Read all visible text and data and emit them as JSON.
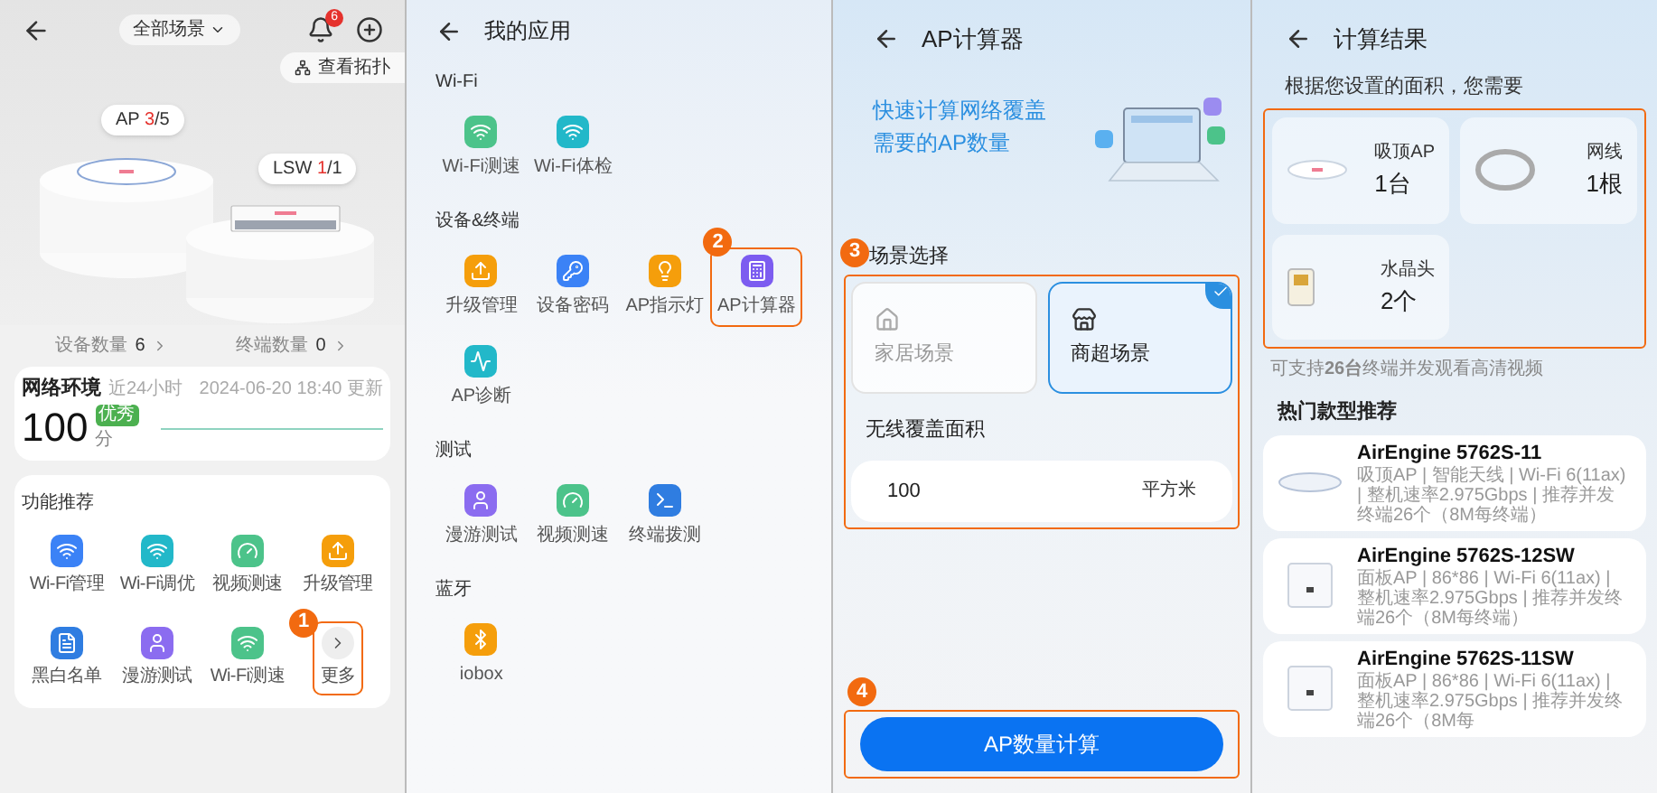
{
  "home": {
    "scope": "全部场景",
    "notifications": "6",
    "topology": "查看拓扑",
    "devices": [
      {
        "name": "AP",
        "online": "3",
        "rest": "/5"
      },
      {
        "name": "LSW",
        "online": "1",
        "rest": "/1"
      }
    ],
    "stats": [
      {
        "label": "设备数量",
        "value": "6"
      },
      {
        "label": "终端数量",
        "value": "0"
      }
    ],
    "network": {
      "title": "网络环境",
      "period": "近24小时",
      "updated": "2024-06-20 18:40 更新",
      "score": "100",
      "grade": "优秀",
      "unit": "分"
    },
    "features": {
      "title": "功能推荐",
      "items": [
        {
          "kind": "app",
          "label": "Wi-Fi管理"
        },
        {
          "kind": "app",
          "label": "Wi-Fi调优"
        },
        {
          "kind": "app",
          "label": "视频测速"
        },
        {
          "kind": "app",
          "label": "升级管理"
        },
        {
          "kind": "app",
          "label": "黑白名单"
        },
        {
          "kind": "app",
          "label": "漫游测试"
        },
        {
          "kind": "app",
          "label": "Wi-Fi测速"
        },
        {
          "kind": "more",
          "label": "更多",
          "step": "1"
        }
      ]
    }
  },
  "apps": {
    "title": "我的应用",
    "sections": [
      {
        "title": "Wi-Fi",
        "items": [
          {
            "label": "Wi-Fi测速"
          },
          {
            "label": "Wi-Fi体检"
          }
        ]
      },
      {
        "title": "设备&终端",
        "items": [
          {
            "label": "升级管理"
          },
          {
            "label": "设备密码"
          },
          {
            "label": "AP指示灯"
          },
          {
            "label": "AP计算器",
            "step": "2"
          },
          {
            "label": "AP诊断"
          }
        ]
      },
      {
        "title": "测试",
        "items": [
          {
            "label": "漫游测试"
          },
          {
            "label": "视频测速"
          },
          {
            "label": "终端拨测"
          }
        ]
      },
      {
        "title": "蓝牙",
        "items": [
          {
            "label": "iobox"
          }
        ]
      }
    ]
  },
  "calculator": {
    "title": "AP计算器",
    "tagline": [
      "快速计算网络覆盖",
      "需要的AP数量"
    ],
    "scene_title": "场景选择",
    "step": "3",
    "scenes": [
      {
        "label": "家居场景",
        "selected": false
      },
      {
        "label": "商超场景",
        "selected": true
      }
    ],
    "area_label": "无线覆盖面积",
    "area_value": "100",
    "area_unit": "平方米",
    "button": "AP数量计算",
    "button_step": "4"
  },
  "result": {
    "title": "计算结果",
    "subtitle": "根据您设置的面积，您需要",
    "items": [
      {
        "name": "吸顶AP",
        "amount": "1台"
      },
      {
        "name": "网线",
        "amount": "1根"
      },
      {
        "name": "水晶头",
        "amount": "2个"
      }
    ],
    "note": "可支持**26台**终端并发观看高清视频",
    "recommend_title": "热门款型推荐",
    "products": [
      {
        "kind": "ceiling",
        "name": "AirEngine 5762S-11",
        "desc": "吸顶AP | 智能天线 | Wi-Fi 6(11ax) | 整机速率2.975Gbps | 推荐并发终端26个（8M每终端）"
      },
      {
        "kind": "panel",
        "name": "AirEngine 5762S-12SW",
        "desc": "面板AP | 86*86 | Wi-Fi 6(11ax) | 整机速率2.975Gbps | 推荐并发终端26个（8M每终端）"
      },
      {
        "kind": "panel",
        "name": "AirEngine 5762S-11SW",
        "desc": "面板AP | 86*86 | Wi-Fi 6(11ax) | 整机速率2.975Gbps | 推荐并发终端26个（8M每"
      }
    ]
  }
}
